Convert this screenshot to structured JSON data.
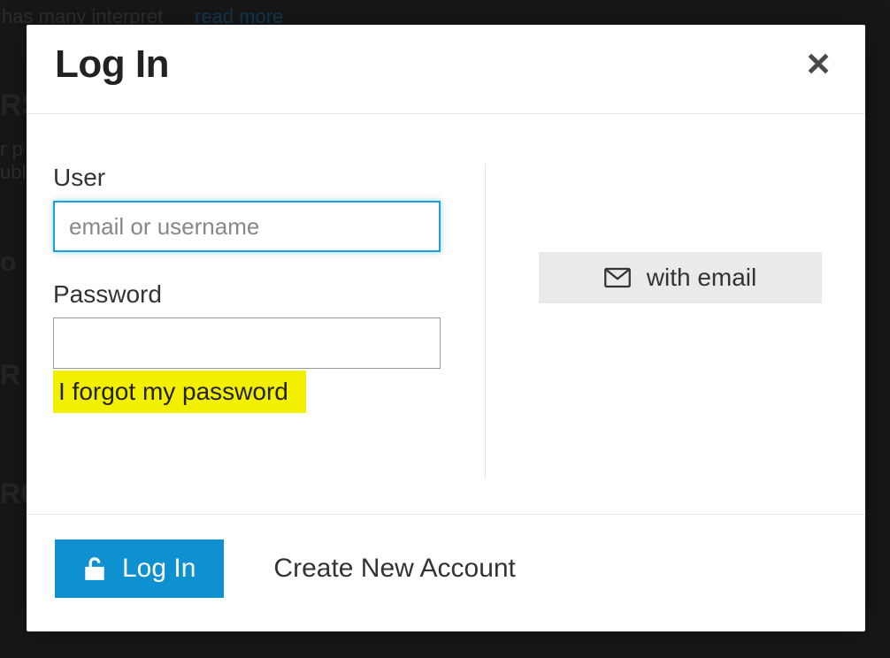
{
  "background": {
    "text1": "has many interpret",
    "readmore": "read more",
    "rs": "RS",
    "rp": "r p",
    "ubl": "ubl",
    "o": "o",
    "r2": "R",
    "rc": "RC"
  },
  "modal": {
    "title": "Log In",
    "user_label": "User",
    "user_placeholder": "email or username",
    "password_label": "Password",
    "forgot_label": "I forgot my password",
    "email_button": "with email",
    "login_button": "Log In",
    "create_account": "Create New Account"
  }
}
